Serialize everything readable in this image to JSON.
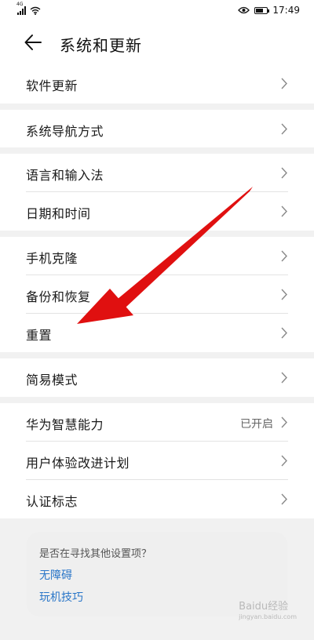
{
  "status_bar": {
    "network_label": "4G",
    "time": "17:49",
    "icons": [
      "signal-icon",
      "wifi-icon",
      "eye-icon",
      "battery-icon"
    ]
  },
  "header": {
    "title": "系统和更新",
    "back_icon": "back-arrow-icon"
  },
  "groups": [
    {
      "items": [
        {
          "label": "软件更新"
        }
      ]
    },
    {
      "items": [
        {
          "label": "系统导航方式"
        }
      ]
    },
    {
      "items": [
        {
          "label": "语言和输入法"
        },
        {
          "label": "日期和时间"
        }
      ]
    },
    {
      "items": [
        {
          "label": "手机克隆"
        },
        {
          "label": "备份和恢复"
        },
        {
          "label": "重置"
        }
      ]
    },
    {
      "items": [
        {
          "label": "简易模式"
        }
      ]
    },
    {
      "items": [
        {
          "label": "华为智慧能力",
          "value": "已开启"
        },
        {
          "label": "用户体验改进计划"
        },
        {
          "label": "认证标志"
        }
      ]
    }
  ],
  "suggestion": {
    "question": "是否在寻找其他设置项？",
    "links": [
      "无障碍",
      "玩机技巧"
    ]
  },
  "annotation": {
    "color": "#e01010"
  },
  "watermark": {
    "text": "Baidu经验",
    "sub": "jingyan.baidu.com"
  }
}
